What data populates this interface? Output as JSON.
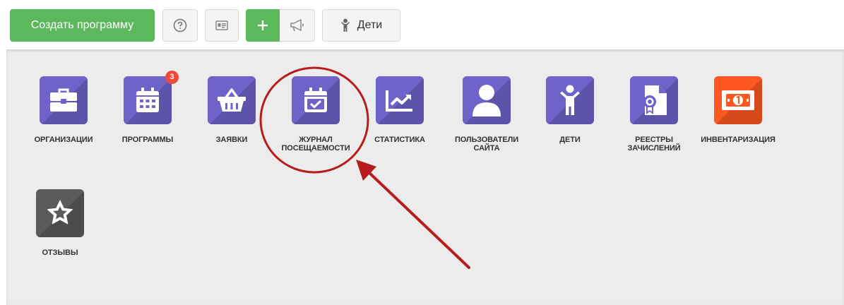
{
  "toolbar": {
    "create_label": "Создать программу",
    "children_label": "Дети"
  },
  "tiles": [
    {
      "label": "ОРГАНИЗАЦИИ",
      "icon": "briefcase-icon",
      "color": "#6f63c9"
    },
    {
      "label": "ПРОГРАММЫ",
      "icon": "calendar-icon",
      "color": "#6f63c9",
      "badge": "3"
    },
    {
      "label": "ЗАЯВКИ",
      "icon": "basket-icon",
      "color": "#6f63c9"
    },
    {
      "label": "ЖУРНАЛ\nПОСЕЩАЕМОСТИ",
      "icon": "calendar-check-icon",
      "color": "#6f63c9"
    },
    {
      "label": "СТАТИСТИКА",
      "icon": "chart-line-icon",
      "color": "#6f63c9"
    },
    {
      "label": "ПОЛЬЗОВАТЕЛИ\nСАЙТА",
      "icon": "user-icon",
      "color": "#6f63c9"
    },
    {
      "label": "ДЕТИ",
      "icon": "child-icon",
      "color": "#6f63c9"
    },
    {
      "label": "РЕЕСТРЫ\nЗАЧИСЛЕНИЙ",
      "icon": "certificate-icon",
      "color": "#6f63c9"
    },
    {
      "label": "ИНВЕНТАРИЗАЦИЯ",
      "icon": "money-icon",
      "color": "#ff5722"
    },
    {
      "label": "ОТЗЫВЫ",
      "icon": "star-icon",
      "color": "#5b5b5b"
    }
  ],
  "annotation": {
    "highlight_color": "#b71c1c"
  }
}
